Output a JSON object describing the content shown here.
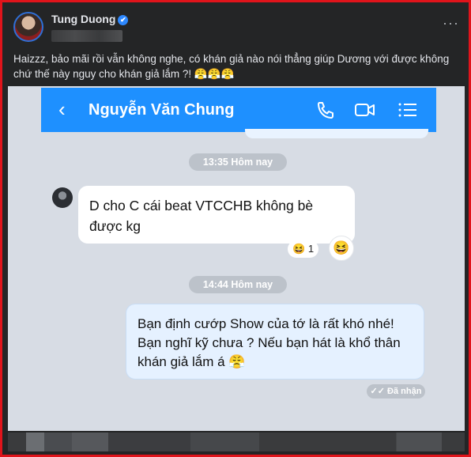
{
  "post": {
    "author": "Tung Duong",
    "verified_mark": "✔",
    "more_label": "···",
    "caption": "Haizzz, bảo mãi rồi vẫn không nghe, có khán giả nào nói thẳng giúp Dương với được không chứ thế này nguy cho khán giả lắm ?! 😤😤😤"
  },
  "chat": {
    "contact_name": "Nguyễn Văn Chung",
    "back_icon": "‹",
    "header_icons": [
      "phone-icon",
      "video-icon",
      "list-icon"
    ],
    "messages": [
      {
        "time": "13:35 Hôm nay"
      },
      {
        "direction": "incoming",
        "text": "D cho C cái beat VTCCHB không bè được kg",
        "reaction": "😆",
        "reaction_count": "1"
      },
      {
        "time": "14:44 Hôm nay"
      },
      {
        "direction": "outgoing",
        "text": "Bạn định cướp Show của tớ là rất khó nhé! Bạn nghĩ kỹ chưa ? Nếu bạn hát là khổ thân khán giả lắm á 😤",
        "status": "✓✓ Đã nhận"
      }
    ]
  },
  "colors": {
    "frame_border": "#e0141b",
    "facebook_dark": "#242526",
    "chat_header": "#1e90ff",
    "outgoing_bubble": "#e5f1ff"
  }
}
